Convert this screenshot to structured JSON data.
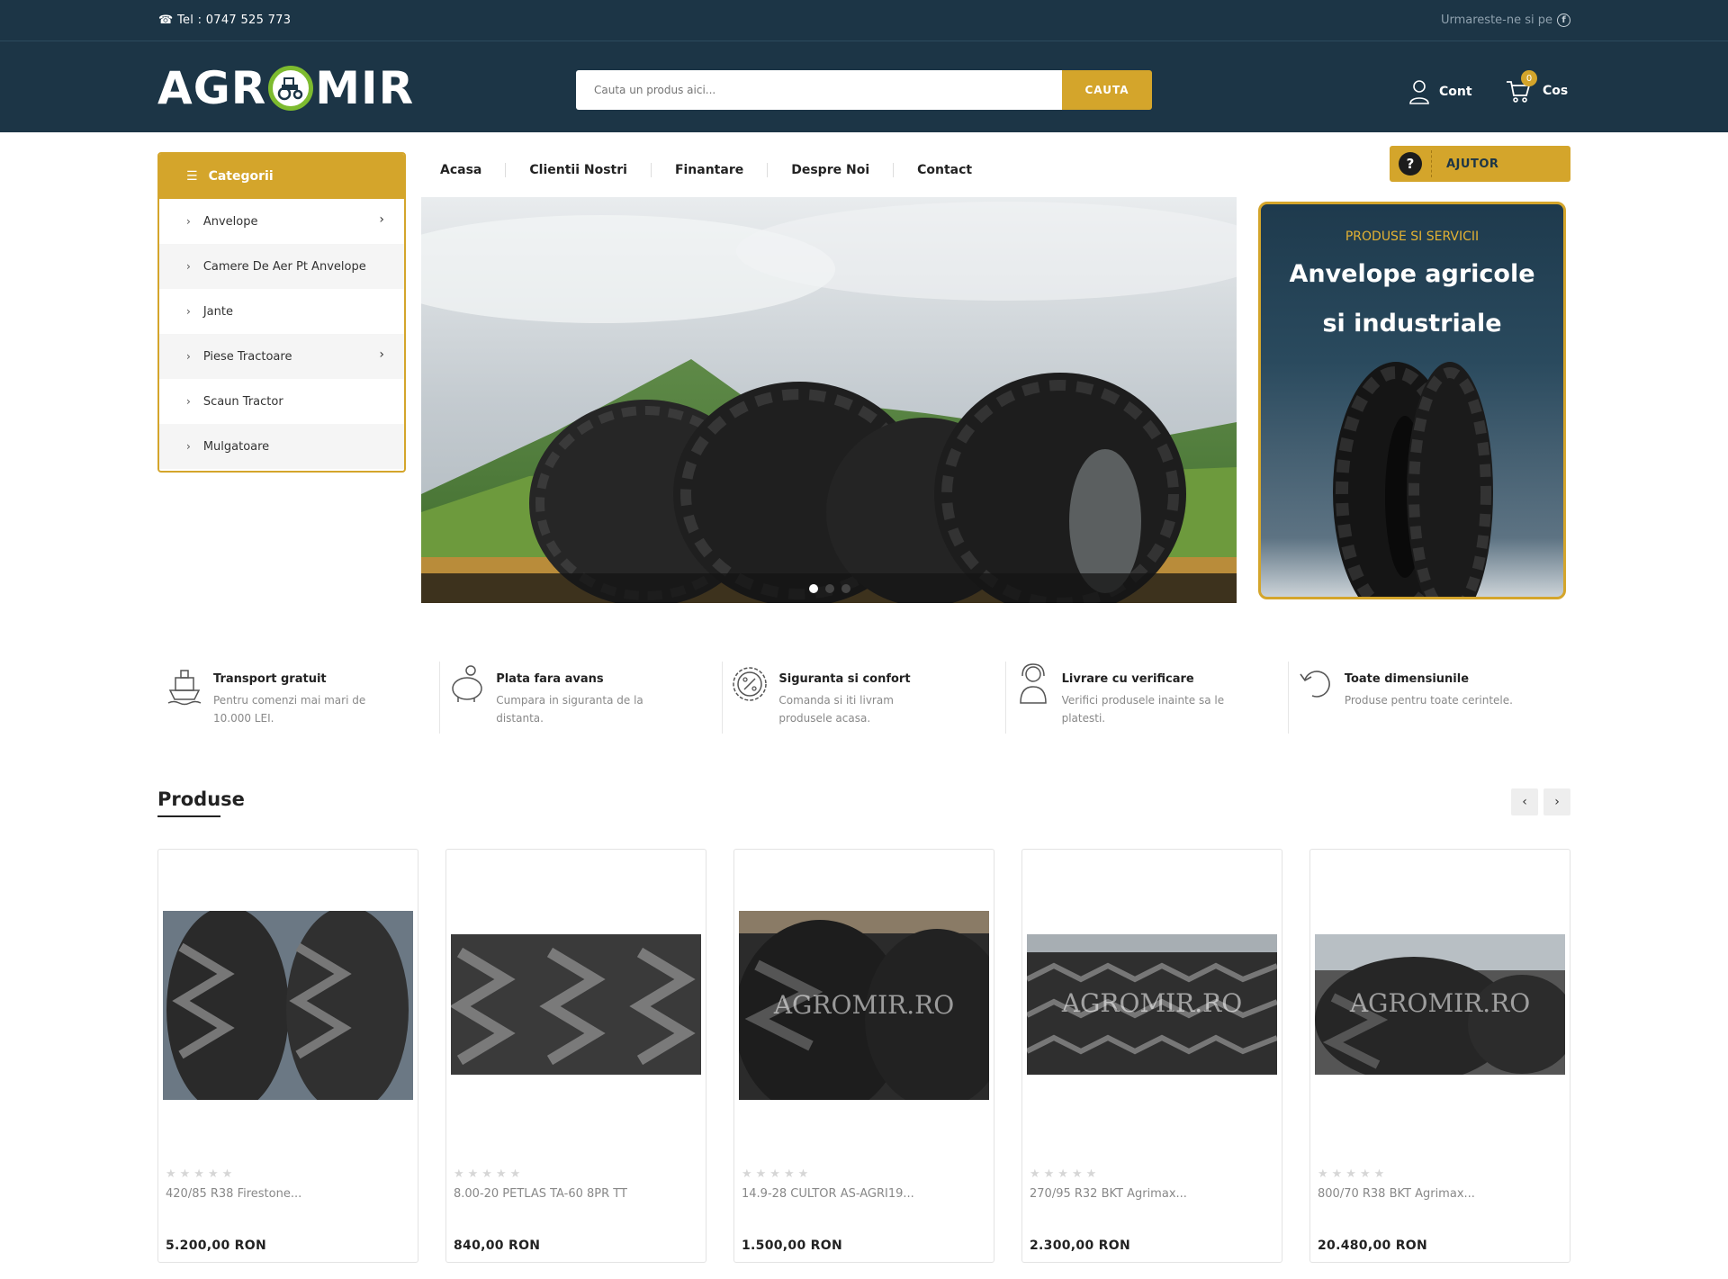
{
  "topbar": {
    "phone": "Tel : 0747 525 773",
    "follow_text": "Urmareste-ne si pe",
    "facebook_icon": "f"
  },
  "header": {
    "logo_left": "AGR",
    "logo_right": "MIR",
    "search_placeholder": "Cauta un produs aici...",
    "search_button": "CAUTA",
    "account_label": "Cont",
    "cart_label": "Cos",
    "cart_count": "0"
  },
  "categories": {
    "title": "Categorii",
    "items": [
      {
        "label": "Anvelope"
      },
      {
        "label": "Camere De Aer Pt Anvelope"
      },
      {
        "label": "Jante"
      },
      {
        "label": "Piese Tractoare"
      },
      {
        "label": "Scaun Tractor"
      },
      {
        "label": "Mulgatoare"
      }
    ]
  },
  "nav": {
    "items": [
      "Acasa",
      "Clientii Nostri",
      "Finantare",
      "Despre Noi",
      "Contact"
    ]
  },
  "help": {
    "icon": "?",
    "label": "AJUTOR"
  },
  "promo": {
    "kicker": "PRODUSE SI SERVICII",
    "line1": "Anvelope agricole",
    "line2": "si industriale"
  },
  "features": [
    {
      "title": "Transport gratuit",
      "desc": "Pentru comenzi mai mari de 10.000 LEI.",
      "icon": "ship-icon"
    },
    {
      "title": "Plata fara avans",
      "desc": "Cumpara in siguranta de la distanta.",
      "icon": "piggy-bank-icon"
    },
    {
      "title": "Siguranta si confort",
      "desc": "Comanda si iti livram produsele acasa.",
      "icon": "percent-badge-icon"
    },
    {
      "title": "Livrare cu verificare",
      "desc": "Verifici produsele inainte sa le platesti.",
      "icon": "support-agent-icon"
    },
    {
      "title": "Toate dimensiunile",
      "desc": "Produse pentru toate cerintele.",
      "icon": "return-arrow-icon"
    }
  ],
  "products_section": {
    "title": "Produse",
    "prev": "‹",
    "next": "›"
  },
  "products": [
    {
      "name": "420/85 R38 Firestone...",
      "price": "5.200,00 RON",
      "stars": "★★★★★",
      "watermark": ""
    },
    {
      "name": "8.00-20 PETLAS TA-60 8PR TT",
      "price": "840,00 RON",
      "stars": "★★★★★",
      "watermark": ""
    },
    {
      "name": "14.9-28 CULTOR AS-AGRI19...",
      "price": "1.500,00 RON",
      "stars": "★★★★★",
      "watermark": "AGROMIR.RO"
    },
    {
      "name": "270/95 R32 BKT Agrimax...",
      "price": "2.300,00 RON",
      "stars": "★★★★★",
      "watermark": "AGROMIR.RO"
    },
    {
      "name": "800/70 R38 BKT Agrimax...",
      "price": "20.480,00 RON",
      "stars": "★★★★★",
      "watermark": "AGROMIR.RO"
    }
  ],
  "colors": {
    "navy": "#1c3546",
    "gold": "#d4a52b",
    "logo_green": "#7dbb2f"
  }
}
